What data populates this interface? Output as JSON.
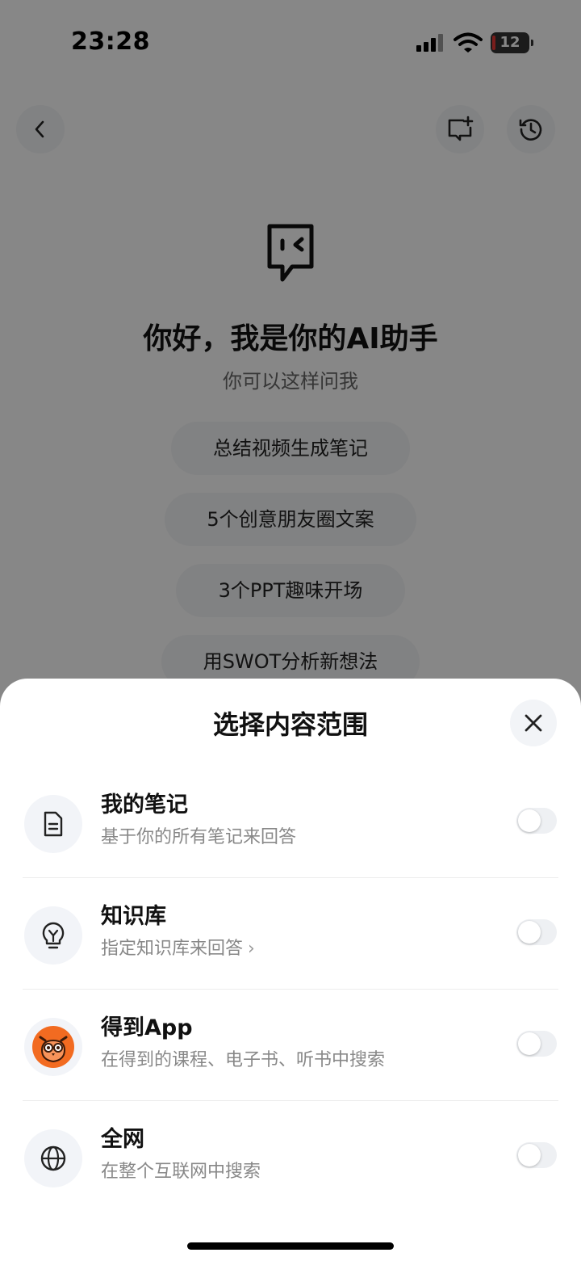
{
  "status_bar": {
    "time": "23:28",
    "battery": "12"
  },
  "nav": {
    "back_icon": "chevron-left-icon",
    "new_chat_icon": "new-chat-icon",
    "history_icon": "history-icon"
  },
  "hero": {
    "title": "你好，我是你的AI助手",
    "subtitle": "你可以这样问我"
  },
  "suggestions": [
    "总结视频生成笔记",
    "5个创意朋友圈文案",
    "3个PPT趣味开场",
    "用SWOT分析新想法"
  ],
  "sheet": {
    "title": "选择内容范围",
    "close_icon": "close-icon",
    "options": [
      {
        "title": "我的笔记",
        "desc": "基于你的所有笔记来回答",
        "icon": "document-icon",
        "enabled": false
      },
      {
        "title": "知识库",
        "desc": "指定知识库来回答",
        "icon": "lightbulb-icon",
        "enabled": false,
        "chevron": "›"
      },
      {
        "title": "得到App",
        "desc": "在得到的课程、电子书、听书中搜索",
        "icon": "owl-logo-icon",
        "enabled": false
      },
      {
        "title": "全网",
        "desc": "在整个互联网中搜索",
        "icon": "globe-icon",
        "enabled": false
      }
    ]
  },
  "colors": {
    "overlay": "#000000",
    "sheet_bg": "#ffffff",
    "toggle_off": "#eef0f3",
    "owl_orange": "#f26b21"
  }
}
